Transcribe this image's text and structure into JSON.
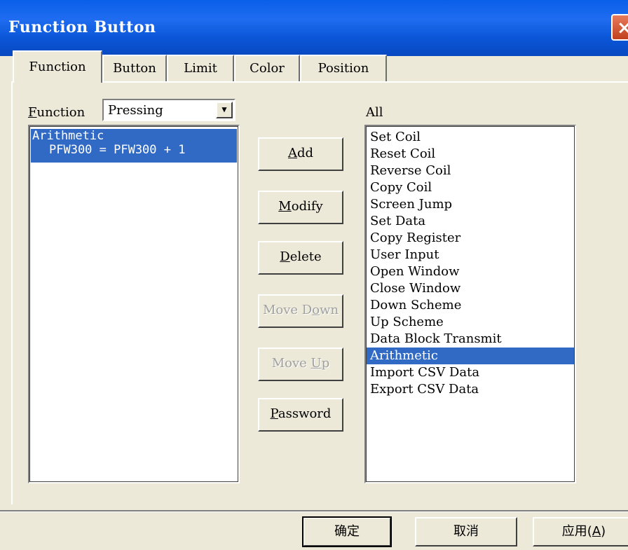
{
  "window": {
    "title": "Function Button",
    "close_label": "×"
  },
  "tabs": [
    {
      "label": "Function"
    },
    {
      "label": "Button"
    },
    {
      "label": "Limit"
    },
    {
      "label": "Color"
    },
    {
      "label": "Position"
    }
  ],
  "function_field": {
    "label_first": "F",
    "label_rest": "unction",
    "value": "Pressing"
  },
  "function_list": {
    "entries": [
      {
        "line1": "Arithmetic",
        "line2": "PFW300 = PFW300 + 1"
      }
    ]
  },
  "all_list": {
    "label": "All",
    "items": [
      "Set Coil",
      "Reset Coil",
      "Reverse Coil",
      "Copy Coil",
      "Screen Jump",
      "Set Data",
      "Copy Register",
      "User Input",
      "Open Window",
      "Close Window",
      "Down Scheme",
      "Up Scheme",
      "Data Block Transmit",
      "Arithmetic",
      "Import CSV Data",
      "Export CSV Data"
    ],
    "selected": "Arithmetic"
  },
  "buttons": {
    "add": {
      "pre": "",
      "mn": "A",
      "post": "dd"
    },
    "modify": {
      "pre": "",
      "mn": "M",
      "post": "odify"
    },
    "delete": {
      "pre": "",
      "mn": "D",
      "post": "elete"
    },
    "move_down": {
      "pre": "Move D",
      "mn": "o",
      "post": "wn"
    },
    "move_up": {
      "pre": "Move ",
      "mn": "U",
      "post": "p"
    },
    "password": {
      "pre": "",
      "mn": "P",
      "post": "assword"
    }
  },
  "footer": {
    "ok": "确定",
    "cancel": "取消",
    "apply": "应用(",
    "apply_mn": "A",
    "apply_end": ")"
  }
}
